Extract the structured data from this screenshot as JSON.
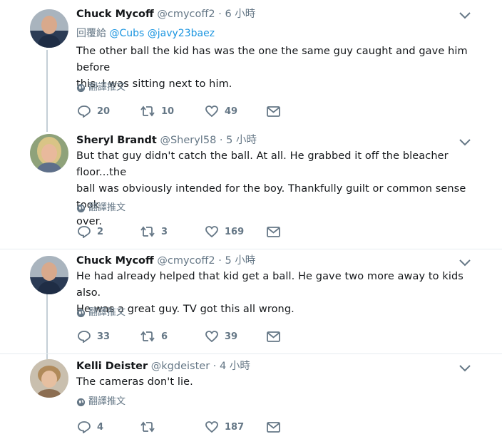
{
  "translate_label": "翻譯推文",
  "tweets": [
    {
      "name": "Chuck Mycoff",
      "handle": "@cmycoff2",
      "separator": "·",
      "time": "6 小時",
      "reply_prefix": "回覆給",
      "reply_mentions": [
        "@Cubs",
        "@javy23baez"
      ],
      "text_lines": [
        "The other ball the kid has was the one the same guy caught and gave him before",
        "this. I was sitting next to him."
      ],
      "replies": "20",
      "retweets": "10",
      "likes": "49"
    },
    {
      "name": "Sheryl Brandt",
      "handle": "@Sheryl58",
      "separator": "·",
      "time": "5 小時",
      "text_lines": [
        "But that guy didn't catch the ball. At all. He grabbed it off the bleacher floor...the",
        "ball was obviously intended for the boy.  Thankfully guilt or common sense took",
        "over."
      ],
      "replies": "2",
      "retweets": "3",
      "likes": "169"
    },
    {
      "name": "Chuck Mycoff",
      "handle": "@cmycoff2",
      "separator": "·",
      "time": "5 小時",
      "text_lines": [
        "He had already helped that kid get a ball. He gave two more away to kids also.",
        "He was a great guy. TV got this all wrong."
      ],
      "replies": "33",
      "retweets": "6",
      "likes": "39"
    },
    {
      "name": "Kelli Deister",
      "handle": "@kgdeister",
      "separator": "·",
      "time": "4 小時",
      "text_lines": [
        "The cameras don't lie."
      ],
      "replies": "4",
      "retweets": "",
      "likes": "187"
    }
  ]
}
